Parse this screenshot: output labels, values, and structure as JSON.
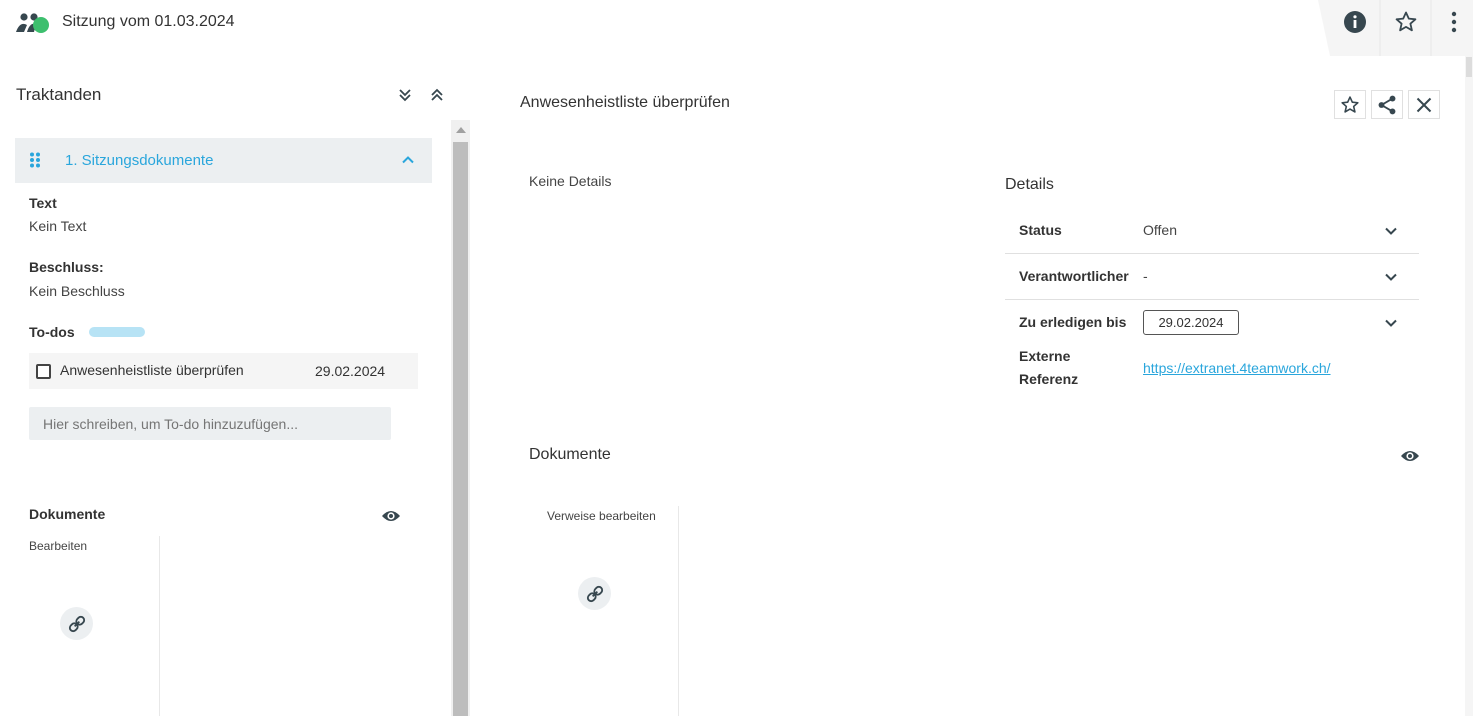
{
  "header": {
    "title": "Sitzung vom 01.03.2024",
    "logo_icon": "group-users-icon",
    "actions": [
      {
        "name": "info",
        "icon": "info-icon"
      },
      {
        "name": "favorite",
        "icon": "star-outline-icon"
      },
      {
        "name": "more",
        "icon": "more-vertical-icon"
      }
    ]
  },
  "left": {
    "title": "Traktanden",
    "agenda_item": {
      "label": "1. Sitzungsdokumente"
    },
    "text_label": "Text",
    "text_value": "Kein Text",
    "decision_label": "Beschluss:",
    "decision_value": "Kein Beschluss",
    "todos_label": "To-dos",
    "todo": {
      "label": "Anwesenheistliste überprüfen",
      "date": "29.02.2024",
      "checked": false
    },
    "todo_input_placeholder": "Hier schreiben, um To-do hinzuzufügen...",
    "documents_label": "Dokumente",
    "edit_label": "Bearbeiten"
  },
  "right": {
    "title": "Anwesenheistliste überprüfen",
    "no_details": "Keine Details",
    "details_heading": "Details",
    "details": {
      "status_label": "Status",
      "status_value": "Offen",
      "responsible_label": "Verantwortlicher",
      "responsible_value": "-",
      "due_label": "Zu erledigen bis",
      "due_value": "29.02.2024",
      "ext_ref_label_line1": "Externe",
      "ext_ref_label_line2": "Referenz",
      "ext_ref_value": "https://extranet.4teamwork.ch/"
    },
    "documents_label": "Dokumente",
    "edit_refs_label": "Verweise bearbeiten"
  },
  "colors": {
    "accent": "#2aa6dc",
    "logo_green": "#3dbf6e",
    "dark": "#37474f",
    "row_bg": "#eceff1"
  }
}
